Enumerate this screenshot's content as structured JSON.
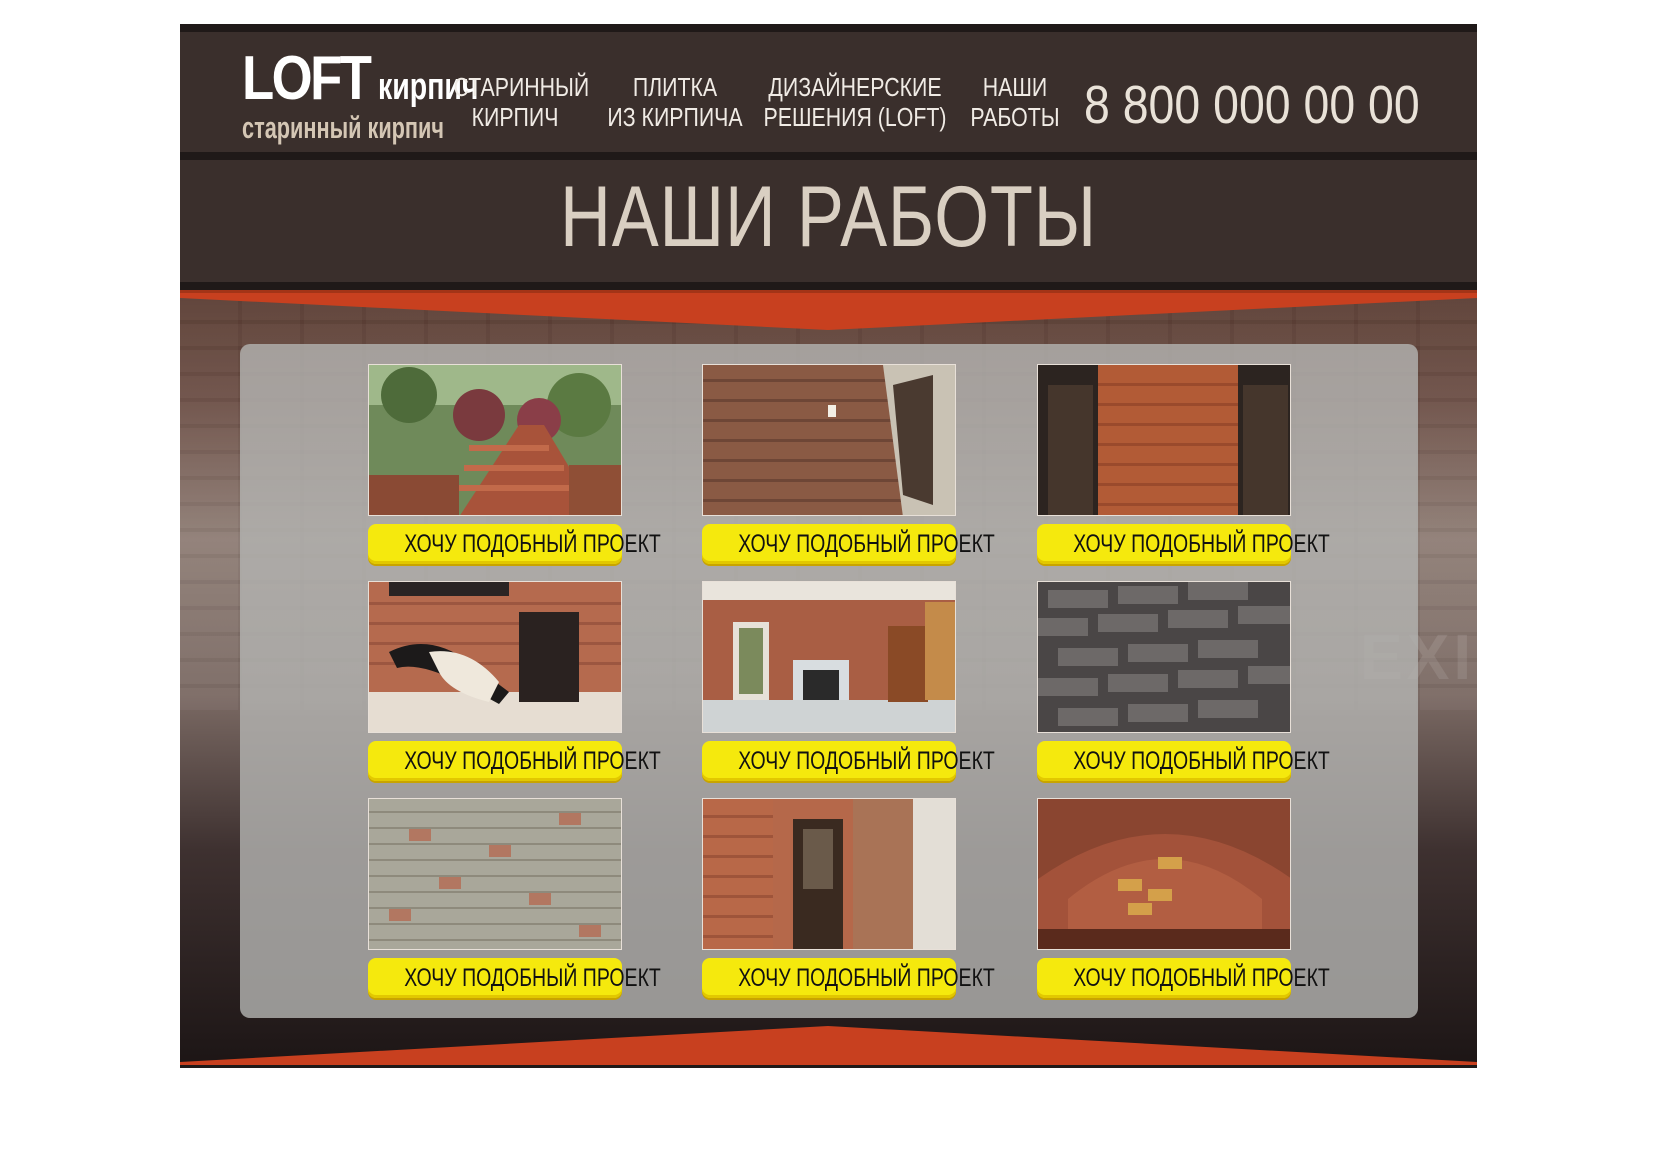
{
  "logo": {
    "main": "LOFT",
    "accent": "кирпич",
    "subtitle": "старинный кирпич"
  },
  "nav": {
    "items": [
      {
        "label": "СТАРИННЫЙ\nКИРПИЧ"
      },
      {
        "label": "ПЛИТКА\nИЗ КИРПИЧА"
      },
      {
        "label": "ДИЗАЙНЕРСКИЕ\nРЕШЕНИЯ (LOFT)"
      },
      {
        "label": "НАШИ\nРАБОТЫ"
      }
    ]
  },
  "phone": "8 800 000 00 00",
  "page": {
    "title": "НАШИ РАБОТЫ"
  },
  "colors": {
    "header_bg": "#3a2f2c",
    "accent_red": "#c8401f",
    "button_yellow": "#f5e90d"
  },
  "projects": [
    {
      "image": "garden-brick-stairs",
      "button_label": "ХОЧУ ПОДОБНЫЙ ПРОЕКТ"
    },
    {
      "image": "brick-corridor-wall",
      "button_label": "ХОЧУ ПОДОБНЫЙ ПРОЕКТ"
    },
    {
      "image": "red-brick-wall-doors",
      "button_label": "ХОЧУ ПОДОБНЫЙ ПРОЕКТ"
    },
    {
      "image": "lounge-chair-brick-room",
      "button_label": "ХОЧУ ПОДОБНЫЙ ПРОЕКТ"
    },
    {
      "image": "room-with-fireplace",
      "button_label": "ХОЧУ ПОДОБНЫЙ ПРОЕКТ"
    },
    {
      "image": "dark-grey-brick-wall",
      "button_label": "ХОЧУ ПОДОБНЫЙ ПРОЕКТ"
    },
    {
      "image": "light-brick-wall",
      "button_label": "ХОЧУ ПОДОБНЫЙ ПРОЕКТ"
    },
    {
      "image": "brick-column-door",
      "button_label": "ХОЧУ ПОДОБНЫЙ ПРОЕКТ"
    },
    {
      "image": "brick-arch-vault",
      "button_label": "ХОЧУ ПОДОБНЫЙ ПРОЕКТ"
    }
  ]
}
